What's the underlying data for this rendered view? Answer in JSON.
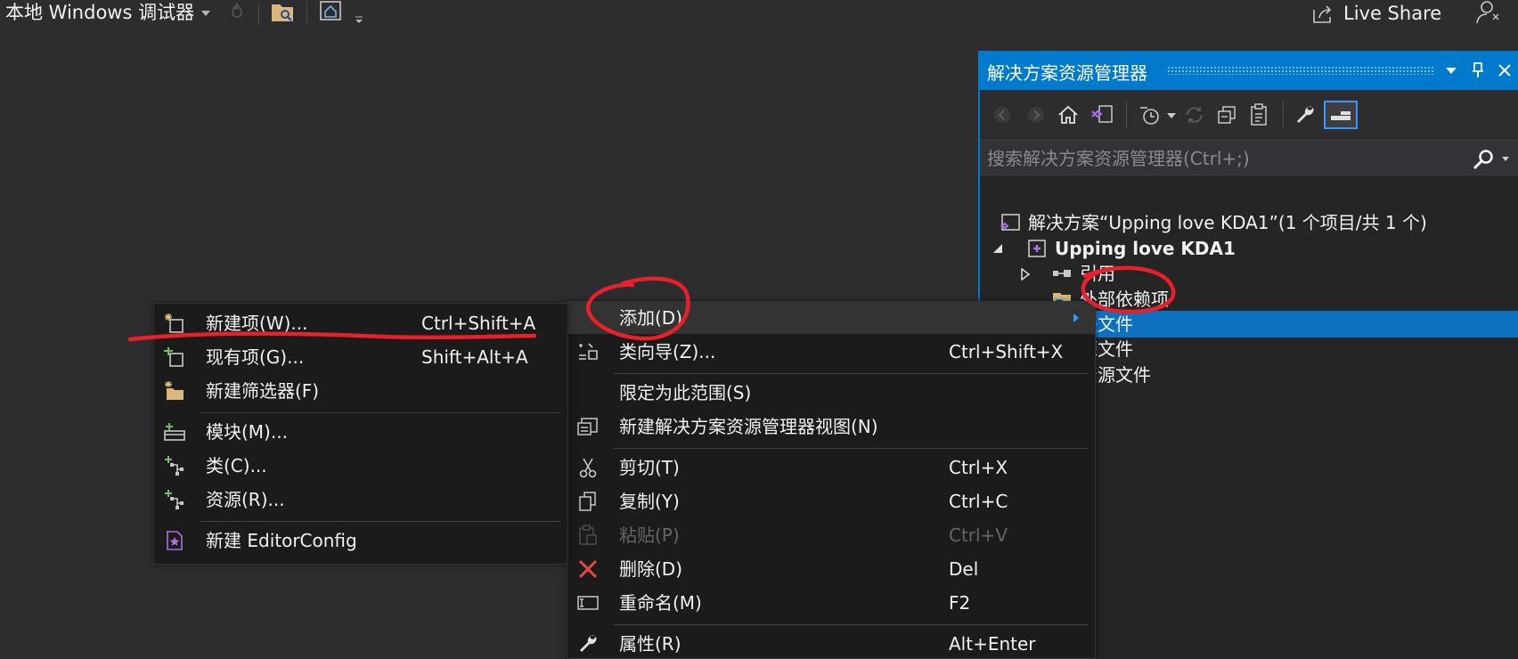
{
  "toolbar": {
    "debugger_label": "本地 Windows 调试器",
    "live_share_label": "Live Share"
  },
  "solution_explorer": {
    "title": "解决方案资源管理器",
    "search_placeholder": "搜索解决方案资源管理器(Ctrl+;)",
    "tree": {
      "solution": "解决方案“Upping love KDA1”(1 个项目/共 1 个)",
      "project": "Upping love KDA1",
      "references": "引用",
      "external_deps": "外部依赖项",
      "header_files": "头文件",
      "source_files": "源文件",
      "resource_files": "资源文件"
    }
  },
  "add_submenu": {
    "items": [
      {
        "label": "新建项(W)...",
        "shortcut": "Ctrl+Shift+A"
      },
      {
        "label": "现有项(G)...",
        "shortcut": "Shift+Alt+A"
      },
      {
        "label": "新建筛选器(F)",
        "shortcut": ""
      },
      {
        "label": "模块(M)...",
        "shortcut": ""
      },
      {
        "label": "类(C)...",
        "shortcut": ""
      },
      {
        "label": "资源(R)...",
        "shortcut": ""
      },
      {
        "label": "新建 EditorConfig",
        "shortcut": ""
      }
    ]
  },
  "context_menu": {
    "items": [
      {
        "label": "添加(D)",
        "shortcut": ""
      },
      {
        "label": "类向导(Z)...",
        "shortcut": "Ctrl+Shift+X"
      },
      {
        "label": "限定为此范围(S)",
        "shortcut": ""
      },
      {
        "label": "新建解决方案资源管理器视图(N)",
        "shortcut": ""
      },
      {
        "label": "剪切(T)",
        "shortcut": "Ctrl+X"
      },
      {
        "label": "复制(Y)",
        "shortcut": "Ctrl+C"
      },
      {
        "label": "粘贴(P)",
        "shortcut": "Ctrl+V"
      },
      {
        "label": "删除(D)",
        "shortcut": "Del"
      },
      {
        "label": "重命名(M)",
        "shortcut": "F2"
      },
      {
        "label": "属性(R)",
        "shortcut": "Alt+Enter"
      }
    ]
  },
  "colors": {
    "background": "#2d2d30",
    "accent": "#007acc",
    "selection": "#0e70c0",
    "annotation": "#e8202a"
  }
}
